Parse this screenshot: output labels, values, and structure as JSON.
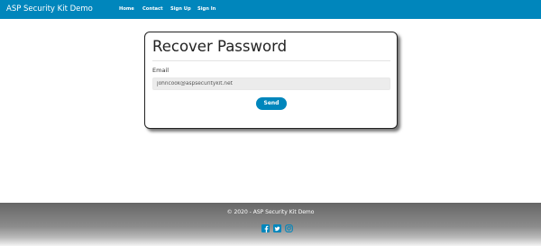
{
  "navbar": {
    "brand": "ASP Security Kit Demo",
    "links": [
      {
        "label": "Home"
      },
      {
        "label": "Contact"
      },
      {
        "label": "Sign Up"
      },
      {
        "label": "Sign In"
      }
    ]
  },
  "form": {
    "title": "Recover Password",
    "email_label": "Email",
    "email_value": "johncook@aspsecuritykit.net",
    "send_label": "Send"
  },
  "footer": {
    "copyright": "© 2020 - ASP Security Kit Demo",
    "social_icons": [
      "facebook-icon",
      "twitter-icon",
      "instagram-icon"
    ]
  },
  "colors": {
    "accent": "#0086bc",
    "footer_top": "#666666"
  }
}
